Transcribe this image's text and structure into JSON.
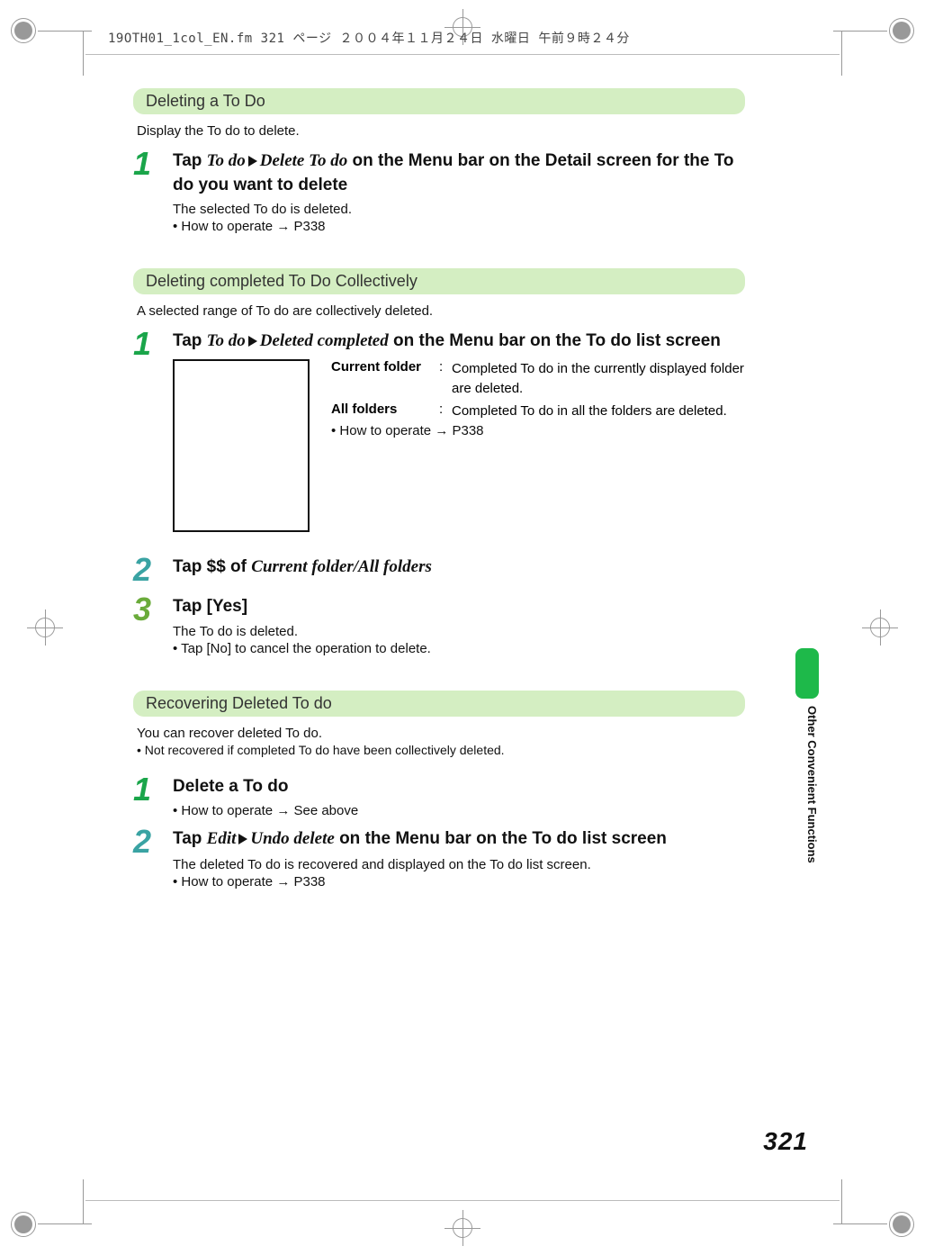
{
  "header_meta": "19OTH01_1col_EN.fm  321 ページ   ２００４年１１月２４日   水曜日   午前９時２４分",
  "section1": {
    "title": "Deleting a To Do",
    "intro": "Display the To do to delete.",
    "steps": [
      {
        "num": "1",
        "title_pre": "Tap ",
        "title_em1": "To do",
        "title_mid": " ",
        "title_em2": "Delete To do",
        "title_post": " on the Menu bar on the Detail screen for the To do you want to delete",
        "note": "The selected To do is deleted.",
        "bullet": "How to operate → P338"
      }
    ]
  },
  "section2": {
    "title": "Deleting completed To Do Collectively",
    "intro": "A selected range of To do are collectively deleted.",
    "steps": [
      {
        "num": "1",
        "title_pre": "Tap ",
        "title_em1": "To do",
        "title_mid": " ",
        "title_em2": "Deleted completed",
        "title_post": " on the Menu bar on the To do list screen",
        "defs": [
          {
            "term": "Current folder",
            "desc": "Completed To do in the currently displayed folder are deleted."
          },
          {
            "term": "All folders",
            "desc": "Completed To do in all the folders are deleted."
          }
        ],
        "bullet": "How to operate → P338"
      },
      {
        "num": "2",
        "title_pre": "Tap $$ of ",
        "title_em1": "Current folder/All folders",
        "title_post": ""
      },
      {
        "num": "3",
        "title_pre": "Tap [Yes]",
        "note": "The To do is deleted.",
        "bullet": "Tap [No] to cancel the operation to delete."
      }
    ]
  },
  "section3": {
    "title": "Recovering Deleted To do",
    "intro": "You can recover deleted To do.",
    "intro_bullet": "Not recovered if completed To do have been collectively deleted.",
    "steps": [
      {
        "num": "1",
        "title_pre": "Delete a To do",
        "bullet": "How to operate  → See above"
      },
      {
        "num": "2",
        "title_pre": "Tap ",
        "title_em1": "Edit",
        "title_mid": " ",
        "title_em2": "Undo delete",
        "title_post": " on the Menu bar on the To do list screen",
        "note": "The deleted To do is recovered and displayed on the To do list screen.",
        "bullet": "How to operate → P338"
      }
    ]
  },
  "side_tab": "Other Convenient Functions",
  "page_number": "321"
}
